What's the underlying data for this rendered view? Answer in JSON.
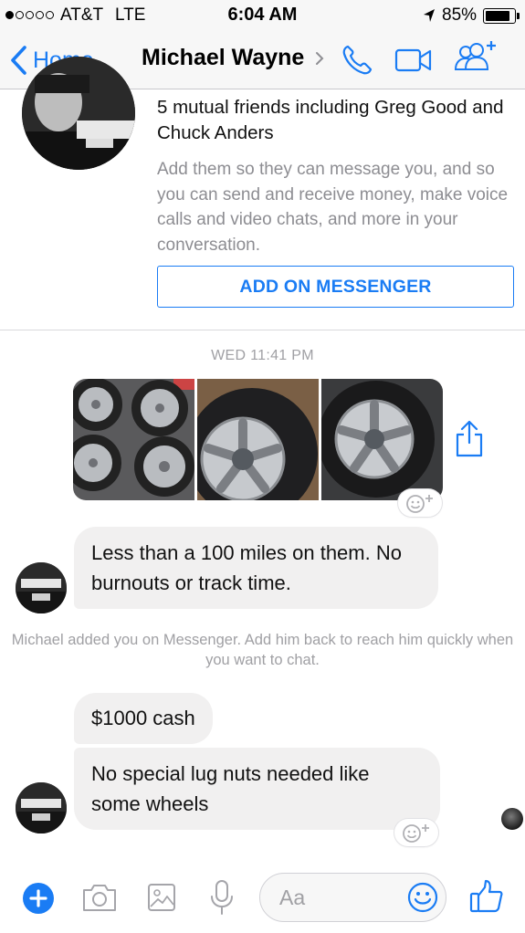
{
  "status_bar": {
    "carrier": "AT&T",
    "network": "LTE",
    "time": "6:04 AM",
    "battery_percent": "85%",
    "battery_level": 0.85,
    "signal_bars": 1
  },
  "header": {
    "back_label": "Home",
    "contact_name": "Michael Wayne",
    "icons": [
      "phone-icon",
      "video-camera-icon",
      "add-people-icon"
    ]
  },
  "friend_card": {
    "mutual_friends": "5 mutual friends including Greg Good and Chuck Anders",
    "description": "Add them so they can message you, and so you can send and receive money, make voice calls and video chats, and more in your conversation.",
    "add_button_label": "ADD ON MESSENGER"
  },
  "conversation": {
    "timestamp": "WED 11:41 PM",
    "photos": [
      "tires-photo-1",
      "tires-photo-2",
      "tires-photo-3"
    ],
    "messages": [
      {
        "text": "Less than a 100 miles on them. No burnouts or track time."
      },
      {
        "text": "$1000 cash"
      },
      {
        "text": "No special lug nuts needed like some wheels"
      }
    ],
    "system_note": "Michael added you on Messenger. Add him back to reach him quickly when you want to chat."
  },
  "composer": {
    "placeholder": "Aa",
    "icons": [
      "plus-icon",
      "camera-icon",
      "gallery-icon",
      "microphone-icon",
      "emoji-icon",
      "thumbs-up-icon"
    ]
  },
  "colors": {
    "accent": "#1a7cf4",
    "bubble": "#f1f0f0",
    "meta_text": "#a0a0a4"
  }
}
